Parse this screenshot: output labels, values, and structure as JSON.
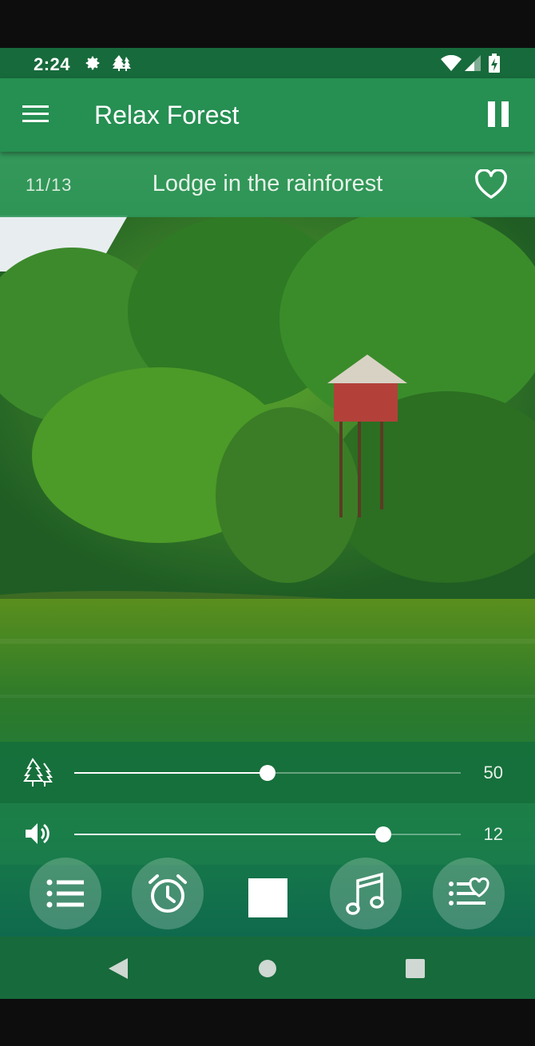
{
  "status_bar": {
    "time": "2:24",
    "icons": [
      "gear-icon",
      "trees-icon",
      "wifi-icon",
      "signal-icon",
      "battery-icon"
    ]
  },
  "app_bar": {
    "title": "Relax Forest",
    "menu_icon": "hamburger-menu-icon",
    "pause_icon": "pause-icon"
  },
  "track": {
    "index": "11/13",
    "title": "Lodge in the rainforest",
    "favorite_icon": "heart-outline-icon"
  },
  "sliders": {
    "forest": {
      "icon": "trees-icon",
      "value": "50",
      "level": 0.5
    },
    "volume": {
      "icon": "speaker-icon",
      "value": "12",
      "level": 0.8
    }
  },
  "controls": [
    "playlist-icon",
    "alarm-clock-icon",
    "stop-icon",
    "music-note-icon",
    "favorites-list-icon"
  ],
  "nav": [
    "back-icon",
    "home-icon",
    "recents-icon"
  ],
  "colors": {
    "status_bar": "#176a3b",
    "app_bar": "#268f52",
    "accent": "#ffffff"
  }
}
